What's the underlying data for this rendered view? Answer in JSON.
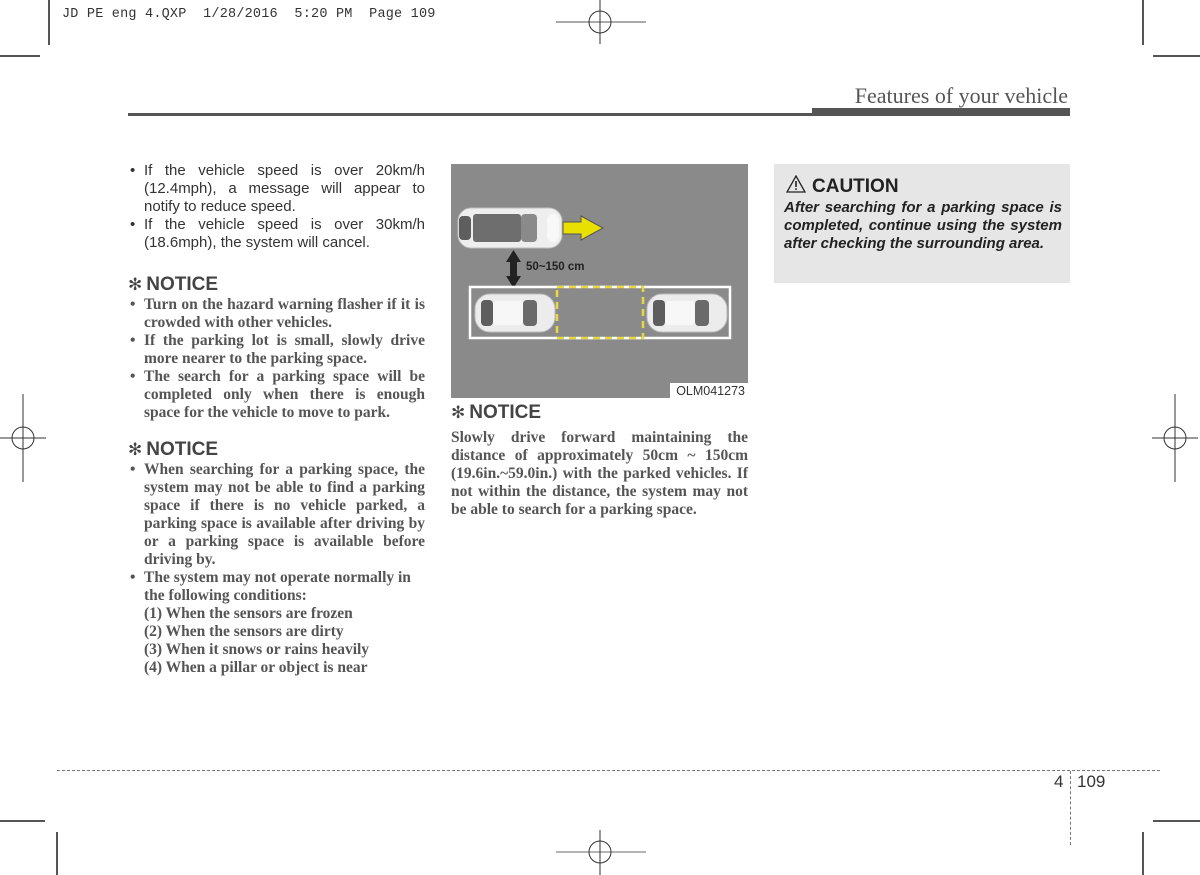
{
  "slug": "JD PE eng 4.QXP  1/28/2016  5:20 PM  Page 109",
  "header": {
    "title": "Features of your vehicle"
  },
  "left_column": {
    "bullets": [
      "If the vehicle speed is over 20km/h (12.4mph), a message will appear to notify to reduce speed.",
      "If the vehicle speed is over 30km/h (18.6mph), the system will cancel."
    ],
    "notice1": {
      "symbol": "✻",
      "title": "NOTICE",
      "items": [
        "Turn on the hazard warning flasher if it is crowded with other vehicles.",
        "If the parking lot is small, slowly drive more nearer to the parking space.",
        "The search for a parking space will be completed only when there is enough space for the vehicle to move to park."
      ]
    },
    "notice2": {
      "symbol": "✻",
      "title": "NOTICE",
      "items": [
        "When searching for a parking space, the system may not be able to find a parking space if there is no vehicle parked, a parking space is available after driving by or a parking space is available before driving by.",
        "The system may not operate normally in the following conditions:"
      ],
      "conditions": [
        "(1) When the sensors are frozen",
        "(2) When the sensors are dirty",
        "(3) When it snows or rains heavily",
        "(4) When a pillar or object is near"
      ]
    }
  },
  "middle_column": {
    "figure": {
      "distance_label": "50~150 cm",
      "code": "OLM041273",
      "colors": {
        "ground": "#8a8a8a",
        "arrow": "#e8e000",
        "dash": "#e8d840"
      }
    },
    "notice": {
      "symbol": "✻",
      "title": "NOTICE",
      "text": "Slowly drive forward maintaining the distance of approximately 50cm ~ 150cm (19.6in.~59.0in.) with the parked vehicles. If not within the distance, the system may not be able to search for a parking space."
    }
  },
  "right_column": {
    "caution": {
      "icon": "warning-triangle",
      "title": "CAUTION",
      "text": "After searching for a parking space is completed, continue using the system after checking the surrounding area."
    }
  },
  "footer": {
    "section": "4",
    "page": "109"
  }
}
